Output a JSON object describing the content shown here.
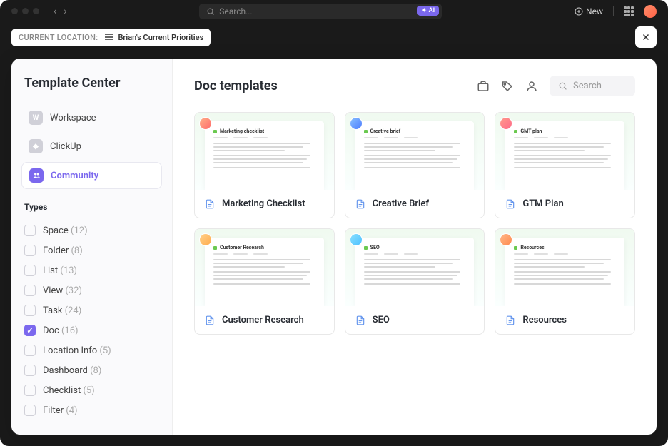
{
  "topbar": {
    "search_placeholder": "Search...",
    "ai_label": "AI",
    "new_label": "New"
  },
  "breadcrumb": {
    "label": "CURRENT LOCATION:",
    "value": "Brian's Current Priorities"
  },
  "sidebar": {
    "title": "Template Center",
    "sources": {
      "workspace": "Workspace",
      "clickup": "ClickUp",
      "community": "Community"
    },
    "types_label": "Types",
    "types": [
      {
        "label": "Space",
        "count": "(12)",
        "checked": false
      },
      {
        "label": "Folder",
        "count": "(8)",
        "checked": false
      },
      {
        "label": "List",
        "count": "(13)",
        "checked": false
      },
      {
        "label": "View",
        "count": "(32)",
        "checked": false
      },
      {
        "label": "Task",
        "count": "(24)",
        "checked": false
      },
      {
        "label": "Doc",
        "count": "(16)",
        "checked": true
      },
      {
        "label": "Location Info",
        "count": "(5)",
        "checked": false
      },
      {
        "label": "Dashboard",
        "count": "(8)",
        "checked": false
      },
      {
        "label": "Checklist",
        "count": "(5)",
        "checked": false
      },
      {
        "label": "Filter",
        "count": "(4)",
        "checked": false
      }
    ]
  },
  "main": {
    "title": "Doc templates",
    "search_placeholder": "Search",
    "cards": [
      {
        "title": "Marketing Checklist",
        "preview": "Marketing checklist"
      },
      {
        "title": "Creative Brief",
        "preview": "Creative brief"
      },
      {
        "title": "GTM Plan",
        "preview": "GMT plan"
      },
      {
        "title": "Customer Research",
        "preview": "Customer Research"
      },
      {
        "title": "SEO",
        "preview": "SEO"
      },
      {
        "title": "Resources",
        "preview": "Resources"
      }
    ]
  }
}
